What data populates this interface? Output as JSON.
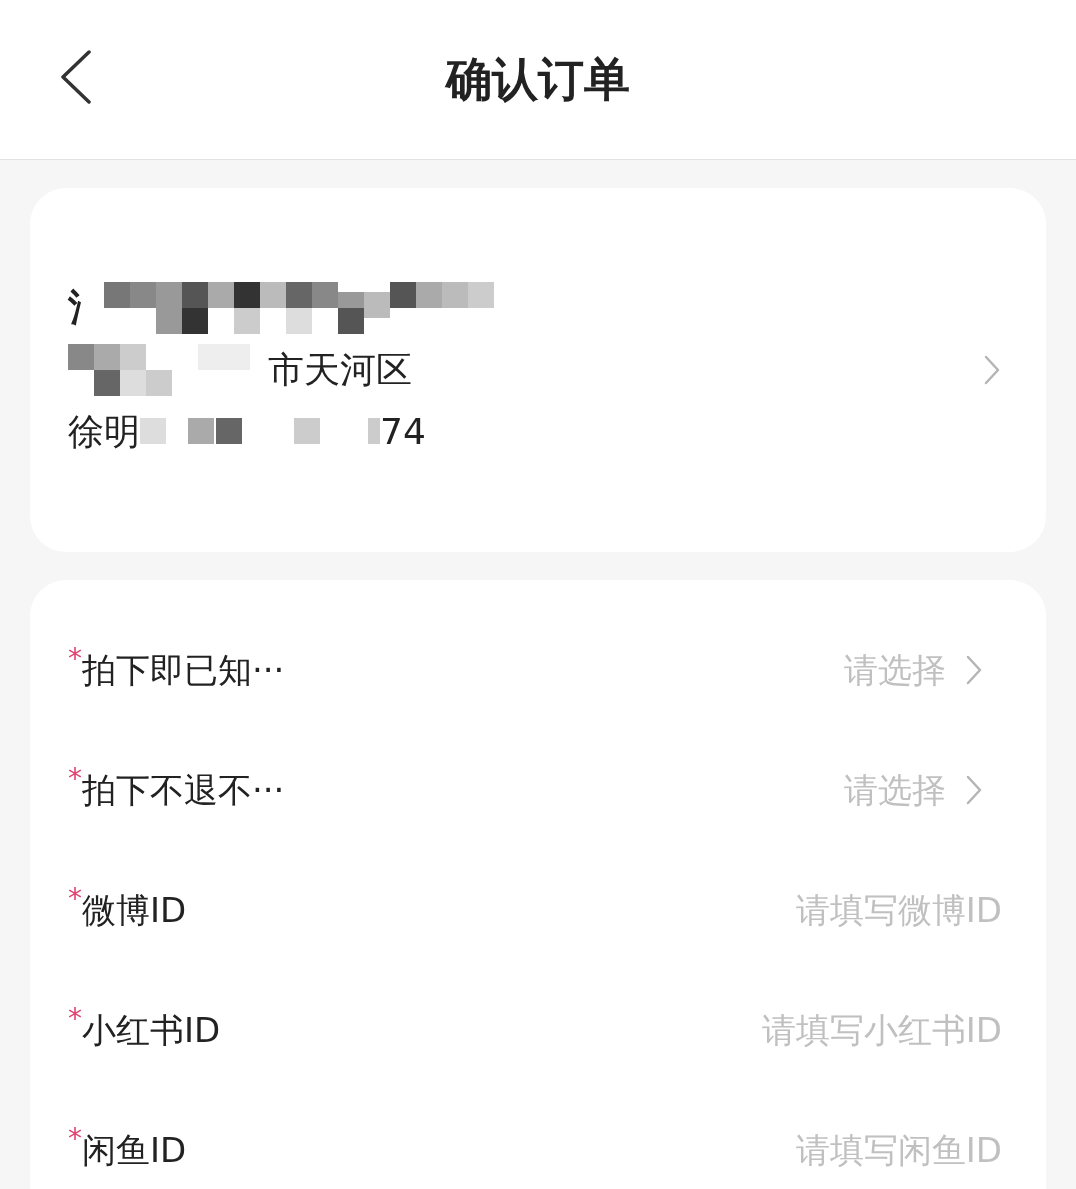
{
  "header": {
    "title": "确认订单"
  },
  "address": {
    "name_visible": "氵",
    "address_visible": "市天河区",
    "contact_start": "徐明",
    "contact_end": "74"
  },
  "form": [
    {
      "kind": "select",
      "required_mark": "*",
      "label": "拍下即已知···",
      "placeholder": "请选择"
    },
    {
      "kind": "select",
      "required_mark": "*",
      "label": "拍下不退不···",
      "placeholder": "请选择"
    },
    {
      "kind": "input",
      "required_mark": "*",
      "label": "微博ID",
      "placeholder": "请填写微博ID"
    },
    {
      "kind": "input",
      "required_mark": "*",
      "label": "小红书ID",
      "placeholder": "请填写小红书ID"
    },
    {
      "kind": "input",
      "required_mark": "*",
      "label": "闲鱼ID",
      "placeholder": "请填写闲鱼ID"
    }
  ]
}
